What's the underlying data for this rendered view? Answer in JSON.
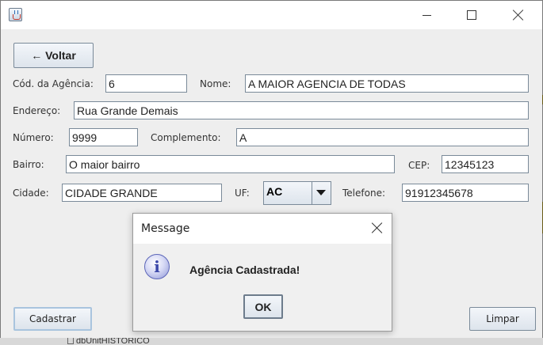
{
  "window": {
    "icon": "java-cup-icon",
    "controls": {
      "minimize": "minimize-icon",
      "maximize": "maximize-icon",
      "close": "close-icon"
    }
  },
  "toolbar": {
    "back_label": "← Voltar"
  },
  "form": {
    "codigo_label": "Cód. da Agência:",
    "codigo_value": "6",
    "nome_label": "Nome:",
    "nome_value": "A MAIOR AGENCIA DE TODAS",
    "endereco_label": "Endereço:",
    "endereco_value": "Rua Grande Demais",
    "numero_label": "Número:",
    "numero_value": "9999",
    "complemento_label": "Complemento:",
    "complemento_value": "A",
    "bairro_label": "Bairro:",
    "bairro_value": "O maior bairro",
    "cep_label": "CEP:",
    "cep_value": "12345123",
    "cidade_label": "Cidade:",
    "cidade_value": "CIDADE GRANDE",
    "uf_label": "UF:",
    "uf_value": "AC",
    "telefone_label": "Telefone:",
    "telefone_value": "91912345678"
  },
  "actions": {
    "cadastrar_label": "Cadastrar",
    "limpar_label": "Limpar"
  },
  "dialog": {
    "title": "Message",
    "icon": "info-icon",
    "icon_glyph": "i",
    "message": "Agência Cadastrada!",
    "ok_label": "OK"
  },
  "background": {
    "partial_text": "dbUnitHISTORICO"
  }
}
